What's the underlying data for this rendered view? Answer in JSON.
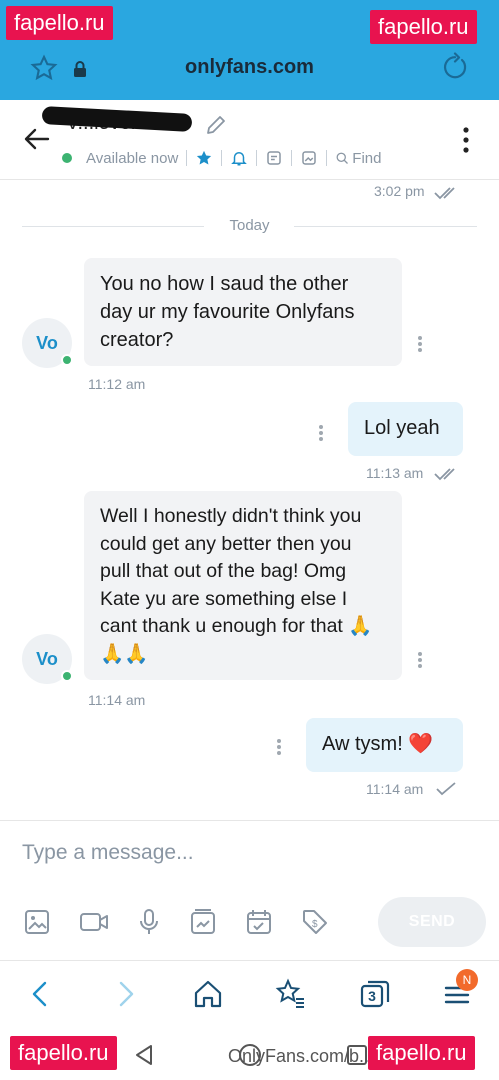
{
  "browser": {
    "url": "onlyfans.com",
    "accent": "#2aa7e0"
  },
  "watermarks": {
    "top_left": "fapello.ru",
    "top_right": "fapello.ru",
    "bottom_left": "fapello.ru",
    "bottom_right": "fapello.ru"
  },
  "header": {
    "contact_name": "V...lover",
    "status": "Available now",
    "find_label": "Find"
  },
  "messages": {
    "earlier_time": "3:02 pm",
    "day_separator": "Today",
    "items": [
      {
        "direction": "in",
        "avatar": "Vo",
        "text": "You no how I saud the other day ur my favourite Onlyfans creator?",
        "time": "11:12 am"
      },
      {
        "direction": "out",
        "text": "Lol yeah",
        "time": "11:13 am",
        "read": true
      },
      {
        "direction": "in",
        "avatar": "Vo",
        "text": "Well I honestly didn't think you could get any better then you pull that out of the bag! Omg Kate yu are something else I cant thank u enough for that 🙏🙏🙏",
        "time": "11:14 am"
      },
      {
        "direction": "out",
        "text": "Aw tysm! ❤️",
        "time": "11:14 am",
        "read": false
      }
    ]
  },
  "composer": {
    "placeholder": "Type a message...",
    "send_label": "SEND"
  },
  "browser_nav": {
    "tab_count": "3",
    "badge": "N"
  },
  "system_bar": {
    "footer_url": "OnlyFans.com/b..."
  },
  "icons": [
    "star-icon",
    "lock-icon",
    "reload-icon",
    "back-arrow-icon",
    "pencil-icon",
    "star-icon",
    "bell-icon",
    "note-icon",
    "image-icon",
    "search-icon",
    "kebab-icon",
    "image-icon",
    "video-icon",
    "mic-icon",
    "vault-icon",
    "calendar-icon",
    "price-tag-icon",
    "back-icon",
    "forward-icon",
    "home-icon",
    "bookmarks-icon",
    "tabs-icon",
    "menu-icon"
  ]
}
